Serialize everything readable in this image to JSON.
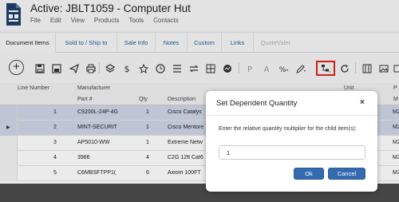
{
  "header": {
    "title": "Active: JBLT1059 - Computer Hut",
    "menu": [
      "File",
      "Edit",
      "View",
      "Products",
      "Tools",
      "Contacts"
    ]
  },
  "tabs": [
    {
      "label": "Document Items",
      "state": "active"
    },
    {
      "label": "Sold to / Ship to",
      "state": "normal"
    },
    {
      "label": "Sale Info",
      "state": "normal"
    },
    {
      "label": "Notes",
      "state": "normal"
    },
    {
      "label": "Custom",
      "state": "normal"
    },
    {
      "label": "Links",
      "state": "normal"
    },
    {
      "label": "QuoteValet",
      "state": "disabled"
    }
  ],
  "toolbar": {
    "add_label": "+",
    "highlighted_tool": "set-dependent-quantity",
    "highlight_color": "#e3221b"
  },
  "grid": {
    "header_row1": {
      "line_number": "Line Number",
      "manufacturer": "Manufacturer",
      "unit": "Unit",
      "extra": "P"
    },
    "header_row2": {
      "part": "Part #",
      "qty": "Qty",
      "description": "Description",
      "extra": "M"
    },
    "rows": [
      {
        "line": "1",
        "part": "C9200L-24P-4G",
        "qty": "1",
        "desc": "Cisco Catalys",
        "extra": "M2",
        "selected": true,
        "current": false
      },
      {
        "line": "2",
        "part": "MINT-SECURIT",
        "qty": "1",
        "desc": "Cisco Mentore",
        "extra": "M2",
        "selected": true,
        "current": true
      },
      {
        "line": "3",
        "part": "AP5010-WW",
        "qty": "1",
        "desc": "Extreme Netw",
        "extra": "M2",
        "selected": false,
        "current": false
      },
      {
        "line": "4",
        "part": "3986",
        "qty": "4",
        "desc": "C2G 12ft Cat6",
        "extra": "M2",
        "selected": false,
        "current": false
      },
      {
        "line": "5",
        "part": "C6MBSFTPP1(",
        "qty": "6",
        "desc": "Axiom 100FT",
        "extra": "M2",
        "selected": false,
        "current": false
      }
    ]
  },
  "dialog": {
    "title": "Set Dependent Quantity",
    "close": "×",
    "message": "Enter the relative quantity multiplier for the child item(s):",
    "value": "1",
    "ok_label": "Ok",
    "cancel_label": "Cancel",
    "button_color": "#346bb0"
  }
}
